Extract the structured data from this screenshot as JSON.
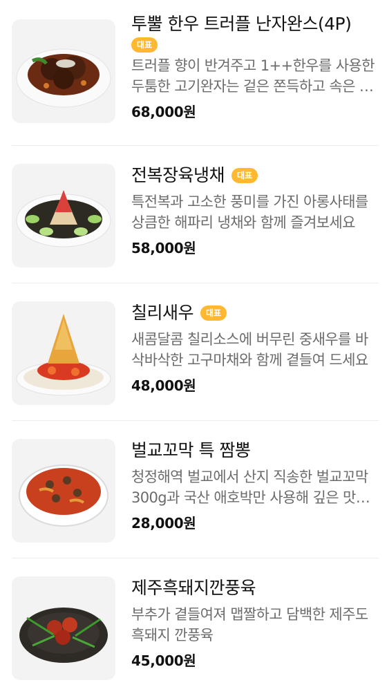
{
  "items": [
    {
      "title": "투뿔 한우 트러플 난자완스(4P)",
      "badge": "대표",
      "description": "트러플 향이 반겨주고 1++한우를 사용한 두툼한 고기완자는 겉은 쫀득하고 속은 부드러워요",
      "price": "68,000원",
      "image_icon": "meatball-dish-image"
    },
    {
      "title": "전복장육냉채",
      "badge": "대표",
      "description": "특전복과 고소한 풍미를 가진 아롱사태를 상큼한 해파리 냉채와 함께 즐겨보세요",
      "price": "58,000원",
      "image_icon": "abalone-cold-dish-image"
    },
    {
      "title": "칠리새우",
      "badge": "대표",
      "description": "새콤달콤 칠리소스에 버무린 중새우를 바삭바삭한 고구마채와 함께 곁들여 드세요",
      "price": "48,000원",
      "image_icon": "chili-shrimp-image"
    },
    {
      "title": "벌교꼬막 특 짬뽕",
      "badge": "",
      "description": "청정해역 벌교에서 산지 직송한 벌교꼬막 300g과 국산 애호박만 사용해 깊은 맛을 냈어요",
      "price": "28,000원",
      "image_icon": "cockle-jjamppong-image"
    },
    {
      "title": "제주흑돼지깐풍육",
      "badge": "",
      "description": "부추가 곁들여져 맵짤하고 담백한 제주도 흑돼지 깐풍육",
      "price": "45,000원",
      "image_icon": "kkanpung-pork-image"
    }
  ],
  "colors": {
    "badge": "#ffb830",
    "description": "#6b6b6b",
    "divider": "#ececec"
  }
}
